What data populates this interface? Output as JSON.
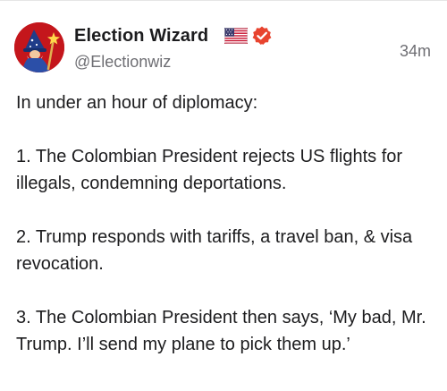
{
  "post": {
    "author": {
      "display_name": "Election Wizard",
      "handle": "@Electionwiz",
      "badges": [
        "us-flag-icon",
        "verified-badge-icon"
      ],
      "avatar": "wizard-avatar"
    },
    "timestamp": "34m",
    "paragraphs": [
      "In under an hour of diplomacy:",
      "1. The Colombian President rejects US flights for illegals, condemning deportations.",
      "2. Trump responds with tariffs, a travel ban, & visa revocation.",
      "3. The Colombian President then says, ‘My bad, Mr. Trump. I’ll send my plane to pick them up.’"
    ]
  },
  "colors": {
    "avatar_background": "#c4161c",
    "verified_badge": "#e8442f",
    "secondary_text": "#6e6e73",
    "primary_text": "#1c1c1e"
  }
}
